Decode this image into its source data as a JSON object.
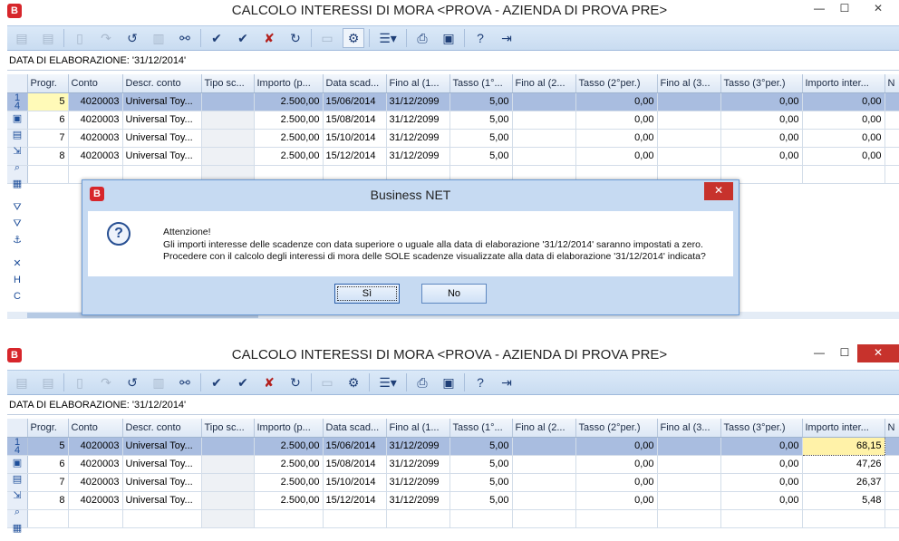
{
  "window1": {
    "title": "CALCOLO INTERESSI DI MORA <PROVA - AZIENDA DI PROVA PRE>",
    "elaboration_label": "DATA DI ELABORAZIONE: '31/12/2014'",
    "row_indicators": [
      "1",
      "4"
    ]
  },
  "window2": {
    "title": "CALCOLO INTERESSI DI MORA <PROVA - AZIENDA DI PROVA PRE>",
    "elaboration_label": "DATA DI ELABORAZIONE: '31/12/2014'",
    "row_indicators": [
      "1",
      "4"
    ]
  },
  "columns": [
    "Progr.",
    "Conto",
    "Descr. conto",
    "Tipo sc...",
    "Importo (p...",
    "Data scad...",
    "Fino al (1...",
    "Tasso (1°...",
    "Fino al (2...",
    "Tasso (2°per.)",
    "Fino al (3...",
    "Tasso (3°per.)",
    "Importo inter...",
    "N"
  ],
  "rows1": [
    {
      "progr": "5",
      "conto": "4020003",
      "descr": "Universal Toy...",
      "tipo": "",
      "importo": "2.500,00",
      "data": "15/06/2014",
      "fino1": "31/12/2099",
      "tasso1": "5,00",
      "fino2": "",
      "tasso2": "0,00",
      "fino3": "",
      "tasso3": "0,00",
      "interessi": "0,00"
    },
    {
      "progr": "6",
      "conto": "4020003",
      "descr": "Universal Toy...",
      "tipo": "",
      "importo": "2.500,00",
      "data": "15/08/2014",
      "fino1": "31/12/2099",
      "tasso1": "5,00",
      "fino2": "",
      "tasso2": "0,00",
      "fino3": "",
      "tasso3": "0,00",
      "interessi": "0,00"
    },
    {
      "progr": "7",
      "conto": "4020003",
      "descr": "Universal Toy...",
      "tipo": "",
      "importo": "2.500,00",
      "data": "15/10/2014",
      "fino1": "31/12/2099",
      "tasso1": "5,00",
      "fino2": "",
      "tasso2": "0,00",
      "fino3": "",
      "tasso3": "0,00",
      "interessi": "0,00"
    },
    {
      "progr": "8",
      "conto": "4020003",
      "descr": "Universal Toy...",
      "tipo": "",
      "importo": "2.500,00",
      "data": "15/12/2014",
      "fino1": "31/12/2099",
      "tasso1": "5,00",
      "fino2": "",
      "tasso2": "0,00",
      "fino3": "",
      "tasso3": "0,00",
      "interessi": "0,00"
    }
  ],
  "rows2": [
    {
      "progr": "5",
      "conto": "4020003",
      "descr": "Universal Toy...",
      "tipo": "",
      "importo": "2.500,00",
      "data": "15/06/2014",
      "fino1": "31/12/2099",
      "tasso1": "5,00",
      "fino2": "",
      "tasso2": "0,00",
      "fino3": "",
      "tasso3": "0,00",
      "interessi": "68,15"
    },
    {
      "progr": "6",
      "conto": "4020003",
      "descr": "Universal Toy...",
      "tipo": "",
      "importo": "2.500,00",
      "data": "15/08/2014",
      "fino1": "31/12/2099",
      "tasso1": "5,00",
      "fino2": "",
      "tasso2": "0,00",
      "fino3": "",
      "tasso3": "0,00",
      "interessi": "47,26"
    },
    {
      "progr": "7",
      "conto": "4020003",
      "descr": "Universal Toy...",
      "tipo": "",
      "importo": "2.500,00",
      "data": "15/10/2014",
      "fino1": "31/12/2099",
      "tasso1": "5,00",
      "fino2": "",
      "tasso2": "0,00",
      "fino3": "",
      "tasso3": "0,00",
      "interessi": "26,37"
    },
    {
      "progr": "8",
      "conto": "4020003",
      "descr": "Universal Toy...",
      "tipo": "",
      "importo": "2.500,00",
      "data": "15/12/2014",
      "fino1": "31/12/2099",
      "tasso1": "5,00",
      "fino2": "",
      "tasso2": "0,00",
      "fino3": "",
      "tasso3": "0,00",
      "interessi": "5,48"
    }
  ],
  "dialog": {
    "title": "Business NET",
    "line1": "Attenzione!",
    "line2": "Gli importi interesse delle scadenze con data superiore o uguale alla data di elaborazione '31/12/2014' saranno impostati a zero.",
    "line3": "Procedere con il calcolo degli interessi di mora delle SOLE scadenze visualizzate alla data di elaborazione '31/12/2014' indicata?",
    "yes_label": "Sì",
    "no_label": "No"
  },
  "icons": {
    "app": "app-logo-icon",
    "question": "question-icon"
  },
  "colors": {
    "selected_row": "#a9bde0",
    "current_cell": "#fffab8",
    "toolbar": "#c9dcf1",
    "close_button": "#c7322c"
  }
}
